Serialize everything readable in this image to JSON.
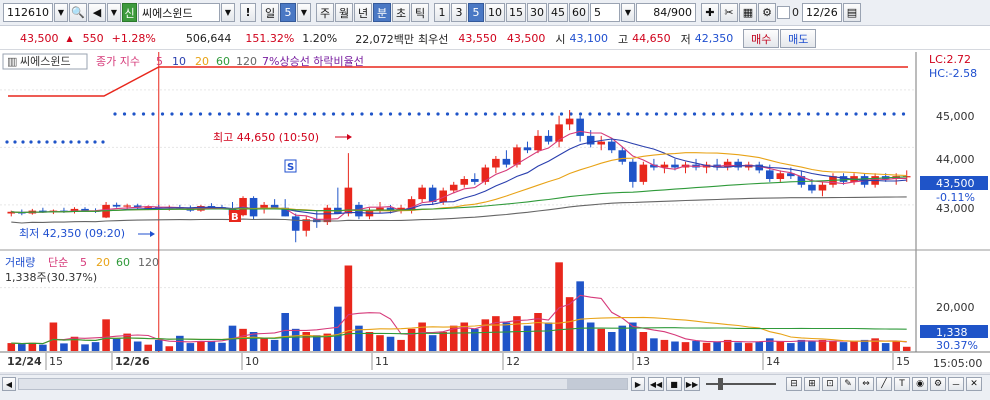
{
  "toolbar": {
    "code": "112610",
    "badge": "신",
    "name": "씨에스윈드",
    "exclaim": "!",
    "period_label": "일",
    "period_value": "5",
    "tabs": [
      "주",
      "월",
      "년",
      "분",
      "초",
      "틱"
    ],
    "selected_tab": "분",
    "intervals": [
      "1",
      "3",
      "5",
      "10",
      "15",
      "30",
      "45",
      "60"
    ],
    "selected_interval": "5",
    "custom_interval": "5",
    "count": "84/900",
    "date": "12/26",
    "checkbox_value": "0"
  },
  "info": {
    "price": "43,500",
    "arrow": "▲",
    "change": "550",
    "change_pct": "+1.28%",
    "volume": "506,644",
    "vol_ratio": "151.32%",
    "turnover_pct": "1.20%",
    "amount": "22,072백만",
    "best_label": "최우선",
    "best_ask": "43,550",
    "best_bid": "43,500",
    "open_label": "시",
    "open": "43,100",
    "high_label": "고",
    "high": "44,650",
    "low_label": "저",
    "low": "42,350",
    "buy_button": "매수",
    "sell_button": "매도"
  },
  "price_panel": {
    "stock_label": "씨에스윈드",
    "ma_label": "종가 지수",
    "ma_periods": [
      "5",
      "10",
      "20",
      "60",
      "120"
    ],
    "extra_label": "7%상승선 하락비율선",
    "lc": "LC:2.72",
    "hc": "HC:-2.58",
    "y_ticks": [
      "45,000",
      "44,000",
      "43,000"
    ],
    "current_price": "43,500",
    "current_pct": "-0.11%",
    "high_note": "최고 44,650 (10:50)",
    "low_note": "최저 42,350 (09:20)",
    "sell_marker": "S",
    "buy_marker": "B"
  },
  "volume_panel": {
    "label": "거래량",
    "ma_label": "단순",
    "ma_periods": [
      "5",
      "20",
      "60",
      "120"
    ],
    "value_note": "1,338주(30.37%)",
    "y_tick": "20,000",
    "current_vol": "1,338",
    "current_pct": "30.37%"
  },
  "time_axis": {
    "labels": [
      "12/24",
      "15",
      "12/26",
      "10",
      "11",
      "12",
      "13",
      "14",
      "15"
    ],
    "clock": "15:05:00"
  },
  "colors": {
    "up": "#e8271c",
    "down": "#1f54c8",
    "ma5": "#d63a7a",
    "ma10": "#2a3fae",
    "ma20": "#e8a317",
    "ma60": "#2f9a3a",
    "ma120": "#666666"
  },
  "chart_data": {
    "type": "candlestick",
    "price_range": [
      42250,
      45450
    ],
    "volume_max": 30000,
    "candles": [
      {
        "o": 42850,
        "h": 42900,
        "l": 42800,
        "c": 42880,
        "v": 2500
      },
      {
        "o": 42880,
        "h": 42920,
        "l": 42820,
        "c": 42850,
        "v": 2200
      },
      {
        "o": 42850,
        "h": 42930,
        "l": 42830,
        "c": 42900,
        "v": 2600
      },
      {
        "o": 42900,
        "h": 42950,
        "l": 42860,
        "c": 42870,
        "v": 2000
      },
      {
        "o": 42870,
        "h": 42920,
        "l": 42840,
        "c": 42900,
        "v": 9000
      },
      {
        "o": 42900,
        "h": 42950,
        "l": 42860,
        "c": 42880,
        "v": 2400
      },
      {
        "o": 42880,
        "h": 42960,
        "l": 42850,
        "c": 42930,
        "v": 4500
      },
      {
        "o": 42930,
        "h": 42960,
        "l": 42880,
        "c": 42900,
        "v": 2100
      },
      {
        "o": 42900,
        "h": 42940,
        "l": 42860,
        "c": 42880,
        "v": 2800
      },
      {
        "o": 42780,
        "h": 43050,
        "l": 42770,
        "c": 43000,
        "v": 10000
      },
      {
        "o": 43000,
        "h": 43040,
        "l": 42950,
        "c": 42970,
        "v": 4000
      },
      {
        "o": 42970,
        "h": 43020,
        "l": 42930,
        "c": 42990,
        "v": 5500
      },
      {
        "o": 42990,
        "h": 43020,
        "l": 42930,
        "c": 42950,
        "v": 3000
      },
      {
        "o": 42950,
        "h": 42990,
        "l": 42910,
        "c": 42960,
        "v": 2000
      },
      {
        "o": 42960,
        "h": 43000,
        "l": 42920,
        "c": 42940,
        "v": 3500
      },
      {
        "o": 42940,
        "h": 42990,
        "l": 42900,
        "c": 42960,
        "v": 1500
      },
      {
        "o": 42960,
        "h": 43000,
        "l": 42920,
        "c": 42950,
        "v": 4800
      },
      {
        "o": 42950,
        "h": 42990,
        "l": 42880,
        "c": 42900,
        "v": 2500
      },
      {
        "o": 42900,
        "h": 43000,
        "l": 42880,
        "c": 42980,
        "v": 3000
      },
      {
        "o": 42980,
        "h": 43030,
        "l": 42940,
        "c": 42960,
        "v": 3200
      },
      {
        "o": 42960,
        "h": 43000,
        "l": 42920,
        "c": 42940,
        "v": 2600
      },
      {
        "o": 42940,
        "h": 43050,
        "l": 42900,
        "c": 42820,
        "v": 8000
      },
      {
        "o": 42820,
        "h": 43150,
        "l": 42800,
        "c": 43120,
        "v": 7000
      },
      {
        "o": 43120,
        "h": 43150,
        "l": 42750,
        "c": 42800,
        "v": 6000
      },
      {
        "o": 42950,
        "h": 43050,
        "l": 42850,
        "c": 43000,
        "v": 4000
      },
      {
        "o": 43000,
        "h": 43100,
        "l": 42950,
        "c": 42950,
        "v": 3500
      },
      {
        "o": 42950,
        "h": 43100,
        "l": 42800,
        "c": 42800,
        "v": 12000
      },
      {
        "o": 42800,
        "h": 42850,
        "l": 42350,
        "c": 42550,
        "v": 7000
      },
      {
        "o": 42550,
        "h": 42800,
        "l": 42450,
        "c": 42750,
        "v": 6000
      },
      {
        "o": 42750,
        "h": 42900,
        "l": 42600,
        "c": 42700,
        "v": 5000
      },
      {
        "o": 42700,
        "h": 43000,
        "l": 42650,
        "c": 42950,
        "v": 5500
      },
      {
        "o": 42950,
        "h": 43300,
        "l": 42850,
        "c": 42850,
        "v": 14000
      },
      {
        "o": 42850,
        "h": 43900,
        "l": 42800,
        "c": 43300,
        "v": 27000
      },
      {
        "o": 43000,
        "h": 43050,
        "l": 42750,
        "c": 42800,
        "v": 8000
      },
      {
        "o": 42800,
        "h": 42950,
        "l": 42750,
        "c": 42900,
        "v": 6000
      },
      {
        "o": 42900,
        "h": 43050,
        "l": 42850,
        "c": 42950,
        "v": 5000
      },
      {
        "o": 42950,
        "h": 43000,
        "l": 42850,
        "c": 42900,
        "v": 4500
      },
      {
        "o": 42900,
        "h": 43000,
        "l": 42850,
        "c": 42950,
        "v": 3500
      },
      {
        "o": 42900,
        "h": 43150,
        "l": 42850,
        "c": 43100,
        "v": 7000
      },
      {
        "o": 43100,
        "h": 43350,
        "l": 43050,
        "c": 43300,
        "v": 9000
      },
      {
        "o": 43300,
        "h": 43350,
        "l": 43000,
        "c": 43050,
        "v": 5000
      },
      {
        "o": 43050,
        "h": 43300,
        "l": 43000,
        "c": 43250,
        "v": 6000
      },
      {
        "o": 43250,
        "h": 43400,
        "l": 43200,
        "c": 43350,
        "v": 8000
      },
      {
        "o": 43350,
        "h": 43500,
        "l": 43300,
        "c": 43450,
        "v": 9000
      },
      {
        "o": 43450,
        "h": 43550,
        "l": 43350,
        "c": 43400,
        "v": 7000
      },
      {
        "o": 43400,
        "h": 43700,
        "l": 43350,
        "c": 43650,
        "v": 10000
      },
      {
        "o": 43650,
        "h": 43850,
        "l": 43550,
        "c": 43800,
        "v": 11000
      },
      {
        "o": 43800,
        "h": 43950,
        "l": 43650,
        "c": 43700,
        "v": 9000
      },
      {
        "o": 43700,
        "h": 44050,
        "l": 43650,
        "c": 44000,
        "v": 11000
      },
      {
        "o": 44000,
        "h": 44100,
        "l": 43900,
        "c": 43950,
        "v": 8000
      },
      {
        "o": 43950,
        "h": 44300,
        "l": 43900,
        "c": 44200,
        "v": 12000
      },
      {
        "o": 44200,
        "h": 44300,
        "l": 44050,
        "c": 44100,
        "v": 9000
      },
      {
        "o": 44100,
        "h": 44550,
        "l": 44000,
        "c": 44400,
        "v": 28000
      },
      {
        "o": 44400,
        "h": 44650,
        "l": 44300,
        "c": 44500,
        "v": 17000
      },
      {
        "o": 44500,
        "h": 44550,
        "l": 44100,
        "c": 44200,
        "v": 22000
      },
      {
        "o": 44200,
        "h": 44300,
        "l": 44000,
        "c": 44050,
        "v": 9000
      },
      {
        "o": 44050,
        "h": 44200,
        "l": 43950,
        "c": 44100,
        "v": 7000
      },
      {
        "o": 44100,
        "h": 44150,
        "l": 43900,
        "c": 43950,
        "v": 6000
      },
      {
        "o": 43950,
        "h": 44000,
        "l": 43700,
        "c": 43750,
        "v": 8000
      },
      {
        "o": 43750,
        "h": 43800,
        "l": 43300,
        "c": 43400,
        "v": 9000
      },
      {
        "o": 43400,
        "h": 43750,
        "l": 43350,
        "c": 43700,
        "v": 6000
      },
      {
        "o": 43700,
        "h": 43800,
        "l": 43600,
        "c": 43650,
        "v": 4000
      },
      {
        "o": 43650,
        "h": 43750,
        "l": 43550,
        "c": 43700,
        "v": 3500
      },
      {
        "o": 43700,
        "h": 43800,
        "l": 43600,
        "c": 43650,
        "v": 3000
      },
      {
        "o": 43650,
        "h": 43750,
        "l": 43550,
        "c": 43700,
        "v": 2800
      },
      {
        "o": 43700,
        "h": 43800,
        "l": 43600,
        "c": 43650,
        "v": 3200
      },
      {
        "o": 43650,
        "h": 43750,
        "l": 43550,
        "c": 43700,
        "v": 2600
      },
      {
        "o": 43700,
        "h": 43800,
        "l": 43600,
        "c": 43650,
        "v": 3000
      },
      {
        "o": 43650,
        "h": 43800,
        "l": 43600,
        "c": 43750,
        "v": 3500
      },
      {
        "o": 43750,
        "h": 43800,
        "l": 43600,
        "c": 43650,
        "v": 2700
      },
      {
        "o": 43650,
        "h": 43750,
        "l": 43600,
        "c": 43700,
        "v": 2500
      },
      {
        "o": 43700,
        "h": 43750,
        "l": 43550,
        "c": 43600,
        "v": 3000
      },
      {
        "o": 43600,
        "h": 43700,
        "l": 43400,
        "c": 43450,
        "v": 4000
      },
      {
        "o": 43450,
        "h": 43600,
        "l": 43400,
        "c": 43550,
        "v": 3000
      },
      {
        "o": 43550,
        "h": 43650,
        "l": 43450,
        "c": 43500,
        "v": 2500
      },
      {
        "o": 43500,
        "h": 43600,
        "l": 43300,
        "c": 43350,
        "v": 3500
      },
      {
        "o": 43350,
        "h": 43450,
        "l": 43200,
        "c": 43250,
        "v": 3000
      },
      {
        "o": 43250,
        "h": 43400,
        "l": 43150,
        "c": 43350,
        "v": 3500
      },
      {
        "o": 43350,
        "h": 43550,
        "l": 43300,
        "c": 43500,
        "v": 3000
      },
      {
        "o": 43500,
        "h": 43550,
        "l": 43350,
        "c": 43400,
        "v": 2800
      },
      {
        "o": 43400,
        "h": 43550,
        "l": 43350,
        "c": 43500,
        "v": 3000
      },
      {
        "o": 43500,
        "h": 43550,
        "l": 43300,
        "c": 43350,
        "v": 3500
      },
      {
        "o": 43350,
        "h": 43550,
        "l": 43300,
        "c": 43500,
        "v": 4000
      },
      {
        "o": 43500,
        "h": 43550,
        "l": 43400,
        "c": 43450,
        "v": 2500
      },
      {
        "o": 43450,
        "h": 43550,
        "l": 43350,
        "c": 43500,
        "v": 3000
      },
      {
        "o": 43500,
        "h": 43600,
        "l": 43400,
        "c": 43500,
        "v": 1338
      }
    ]
  }
}
